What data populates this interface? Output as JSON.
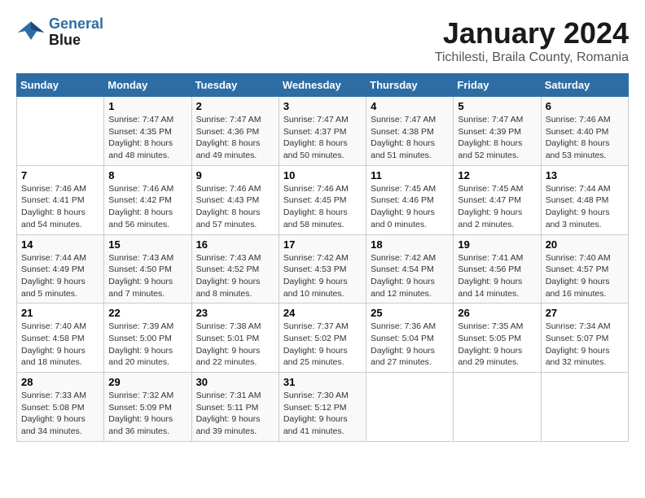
{
  "logo": {
    "line1": "General",
    "line2": "Blue"
  },
  "title": "January 2024",
  "subtitle": "Tichilesti, Braila County, Romania",
  "days_of_week": [
    "Sunday",
    "Monday",
    "Tuesday",
    "Wednesday",
    "Thursday",
    "Friday",
    "Saturday"
  ],
  "weeks": [
    [
      {
        "num": "",
        "sunrise": "",
        "sunset": "",
        "daylight": ""
      },
      {
        "num": "1",
        "sunrise": "Sunrise: 7:47 AM",
        "sunset": "Sunset: 4:35 PM",
        "daylight": "Daylight: 8 hours and 48 minutes."
      },
      {
        "num": "2",
        "sunrise": "Sunrise: 7:47 AM",
        "sunset": "Sunset: 4:36 PM",
        "daylight": "Daylight: 8 hours and 49 minutes."
      },
      {
        "num": "3",
        "sunrise": "Sunrise: 7:47 AM",
        "sunset": "Sunset: 4:37 PM",
        "daylight": "Daylight: 8 hours and 50 minutes."
      },
      {
        "num": "4",
        "sunrise": "Sunrise: 7:47 AM",
        "sunset": "Sunset: 4:38 PM",
        "daylight": "Daylight: 8 hours and 51 minutes."
      },
      {
        "num": "5",
        "sunrise": "Sunrise: 7:47 AM",
        "sunset": "Sunset: 4:39 PM",
        "daylight": "Daylight: 8 hours and 52 minutes."
      },
      {
        "num": "6",
        "sunrise": "Sunrise: 7:46 AM",
        "sunset": "Sunset: 4:40 PM",
        "daylight": "Daylight: 8 hours and 53 minutes."
      }
    ],
    [
      {
        "num": "7",
        "sunrise": "Sunrise: 7:46 AM",
        "sunset": "Sunset: 4:41 PM",
        "daylight": "Daylight: 8 hours and 54 minutes."
      },
      {
        "num": "8",
        "sunrise": "Sunrise: 7:46 AM",
        "sunset": "Sunset: 4:42 PM",
        "daylight": "Daylight: 8 hours and 56 minutes."
      },
      {
        "num": "9",
        "sunrise": "Sunrise: 7:46 AM",
        "sunset": "Sunset: 4:43 PM",
        "daylight": "Daylight: 8 hours and 57 minutes."
      },
      {
        "num": "10",
        "sunrise": "Sunrise: 7:46 AM",
        "sunset": "Sunset: 4:45 PM",
        "daylight": "Daylight: 8 hours and 58 minutes."
      },
      {
        "num": "11",
        "sunrise": "Sunrise: 7:45 AM",
        "sunset": "Sunset: 4:46 PM",
        "daylight": "Daylight: 9 hours and 0 minutes."
      },
      {
        "num": "12",
        "sunrise": "Sunrise: 7:45 AM",
        "sunset": "Sunset: 4:47 PM",
        "daylight": "Daylight: 9 hours and 2 minutes."
      },
      {
        "num": "13",
        "sunrise": "Sunrise: 7:44 AM",
        "sunset": "Sunset: 4:48 PM",
        "daylight": "Daylight: 9 hours and 3 minutes."
      }
    ],
    [
      {
        "num": "14",
        "sunrise": "Sunrise: 7:44 AM",
        "sunset": "Sunset: 4:49 PM",
        "daylight": "Daylight: 9 hours and 5 minutes."
      },
      {
        "num": "15",
        "sunrise": "Sunrise: 7:43 AM",
        "sunset": "Sunset: 4:50 PM",
        "daylight": "Daylight: 9 hours and 7 minutes."
      },
      {
        "num": "16",
        "sunrise": "Sunrise: 7:43 AM",
        "sunset": "Sunset: 4:52 PM",
        "daylight": "Daylight: 9 hours and 8 minutes."
      },
      {
        "num": "17",
        "sunrise": "Sunrise: 7:42 AM",
        "sunset": "Sunset: 4:53 PM",
        "daylight": "Daylight: 9 hours and 10 minutes."
      },
      {
        "num": "18",
        "sunrise": "Sunrise: 7:42 AM",
        "sunset": "Sunset: 4:54 PM",
        "daylight": "Daylight: 9 hours and 12 minutes."
      },
      {
        "num": "19",
        "sunrise": "Sunrise: 7:41 AM",
        "sunset": "Sunset: 4:56 PM",
        "daylight": "Daylight: 9 hours and 14 minutes."
      },
      {
        "num": "20",
        "sunrise": "Sunrise: 7:40 AM",
        "sunset": "Sunset: 4:57 PM",
        "daylight": "Daylight: 9 hours and 16 minutes."
      }
    ],
    [
      {
        "num": "21",
        "sunrise": "Sunrise: 7:40 AM",
        "sunset": "Sunset: 4:58 PM",
        "daylight": "Daylight: 9 hours and 18 minutes."
      },
      {
        "num": "22",
        "sunrise": "Sunrise: 7:39 AM",
        "sunset": "Sunset: 5:00 PM",
        "daylight": "Daylight: 9 hours and 20 minutes."
      },
      {
        "num": "23",
        "sunrise": "Sunrise: 7:38 AM",
        "sunset": "Sunset: 5:01 PM",
        "daylight": "Daylight: 9 hours and 22 minutes."
      },
      {
        "num": "24",
        "sunrise": "Sunrise: 7:37 AM",
        "sunset": "Sunset: 5:02 PM",
        "daylight": "Daylight: 9 hours and 25 minutes."
      },
      {
        "num": "25",
        "sunrise": "Sunrise: 7:36 AM",
        "sunset": "Sunset: 5:04 PM",
        "daylight": "Daylight: 9 hours and 27 minutes."
      },
      {
        "num": "26",
        "sunrise": "Sunrise: 7:35 AM",
        "sunset": "Sunset: 5:05 PM",
        "daylight": "Daylight: 9 hours and 29 minutes."
      },
      {
        "num": "27",
        "sunrise": "Sunrise: 7:34 AM",
        "sunset": "Sunset: 5:07 PM",
        "daylight": "Daylight: 9 hours and 32 minutes."
      }
    ],
    [
      {
        "num": "28",
        "sunrise": "Sunrise: 7:33 AM",
        "sunset": "Sunset: 5:08 PM",
        "daylight": "Daylight: 9 hours and 34 minutes."
      },
      {
        "num": "29",
        "sunrise": "Sunrise: 7:32 AM",
        "sunset": "Sunset: 5:09 PM",
        "daylight": "Daylight: 9 hours and 36 minutes."
      },
      {
        "num": "30",
        "sunrise": "Sunrise: 7:31 AM",
        "sunset": "Sunset: 5:11 PM",
        "daylight": "Daylight: 9 hours and 39 minutes."
      },
      {
        "num": "31",
        "sunrise": "Sunrise: 7:30 AM",
        "sunset": "Sunset: 5:12 PM",
        "daylight": "Daylight: 9 hours and 41 minutes."
      },
      {
        "num": "",
        "sunrise": "",
        "sunset": "",
        "daylight": ""
      },
      {
        "num": "",
        "sunrise": "",
        "sunset": "",
        "daylight": ""
      },
      {
        "num": "",
        "sunrise": "",
        "sunset": "",
        "daylight": ""
      }
    ]
  ]
}
